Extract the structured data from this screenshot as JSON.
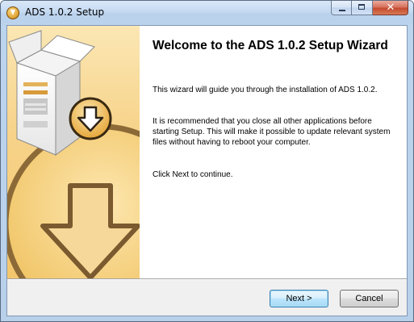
{
  "window": {
    "title": "ADS 1.0.2 Setup",
    "icon": "installer-icon"
  },
  "caption": {
    "minimize": "minimize-icon",
    "maximize": "maximize-icon",
    "close": "close-icon",
    "close_glyph": "✕"
  },
  "welcome": {
    "heading": "Welcome to the ADS 1.0.2 Setup Wizard",
    "paragraphs": [
      "This wizard will guide you through the installation of ADS 1.0.2.",
      "It is recommended that you close all other applications before starting Setup. This will make it possible to update relevant system files without having to reboot your computer.",
      "Click Next to continue."
    ]
  },
  "buttons": {
    "next": "Next >",
    "cancel": "Cancel"
  },
  "colors": {
    "side_panel": "#f7d48c",
    "arrow_brown": "#7a5a2e",
    "title_bar": "#c5daf1",
    "close_red": "#c44a2f"
  }
}
